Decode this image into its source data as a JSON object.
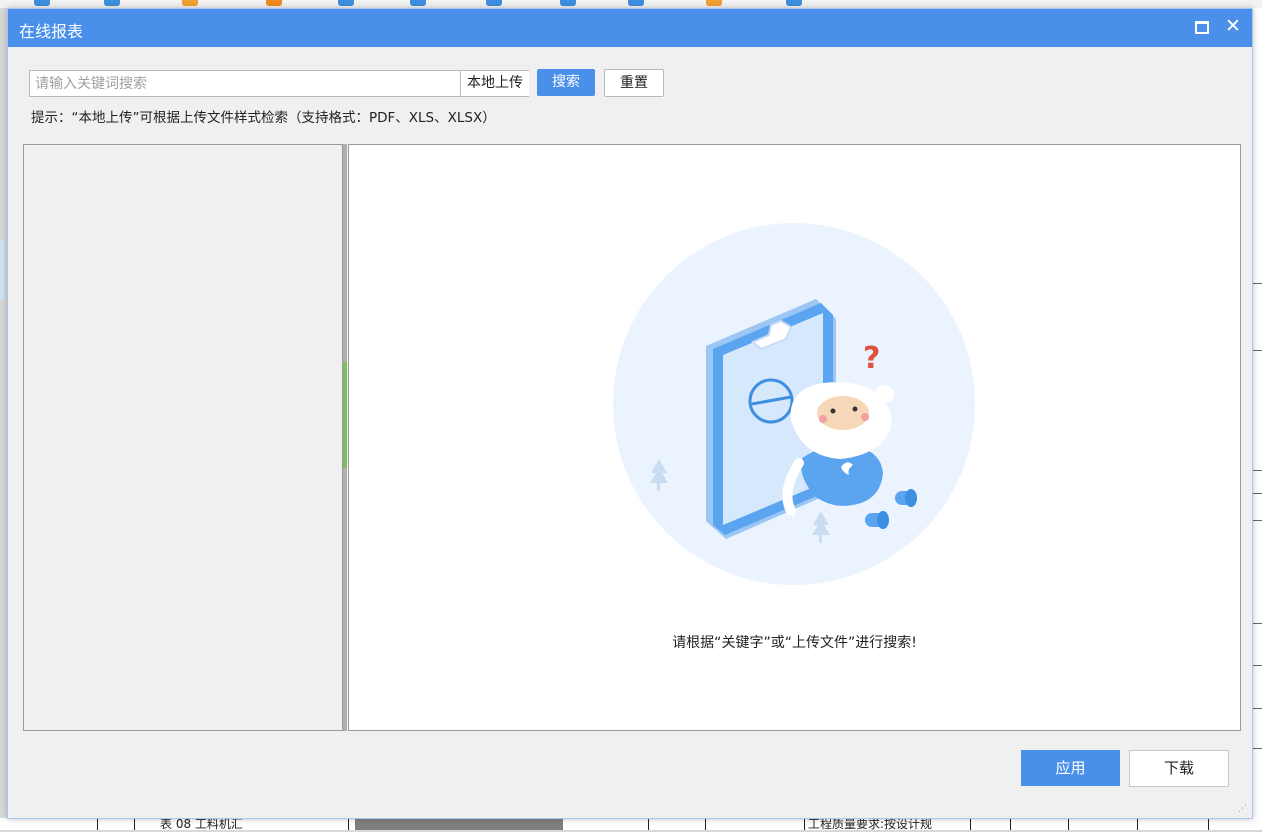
{
  "dialog": {
    "title": "在线报表",
    "search": {
      "placeholder": "请输入关键词搜索",
      "value": "",
      "upload_label": "本地上传",
      "search_label": "搜索",
      "reset_label": "重置"
    },
    "hint": "提示：“本地上传”可根据上传文件样式检索（支持格式：PDF、XLS、XLSX）",
    "empty_state": {
      "message": "请根据“关键字”或“上传文件”进行搜索!",
      "illustration": "empty-search-illustration"
    },
    "buttons": {
      "apply_label": "应用",
      "download_label": "下载"
    }
  },
  "background_app": {
    "bottom_row_texts": [
      "表 08 工料机汇",
      "工程质量要求:按设计规"
    ]
  },
  "colors": {
    "titlebar": "#4a90ea",
    "primary_button": "#4a90ea",
    "splitter_grip": "#7cc05a"
  }
}
